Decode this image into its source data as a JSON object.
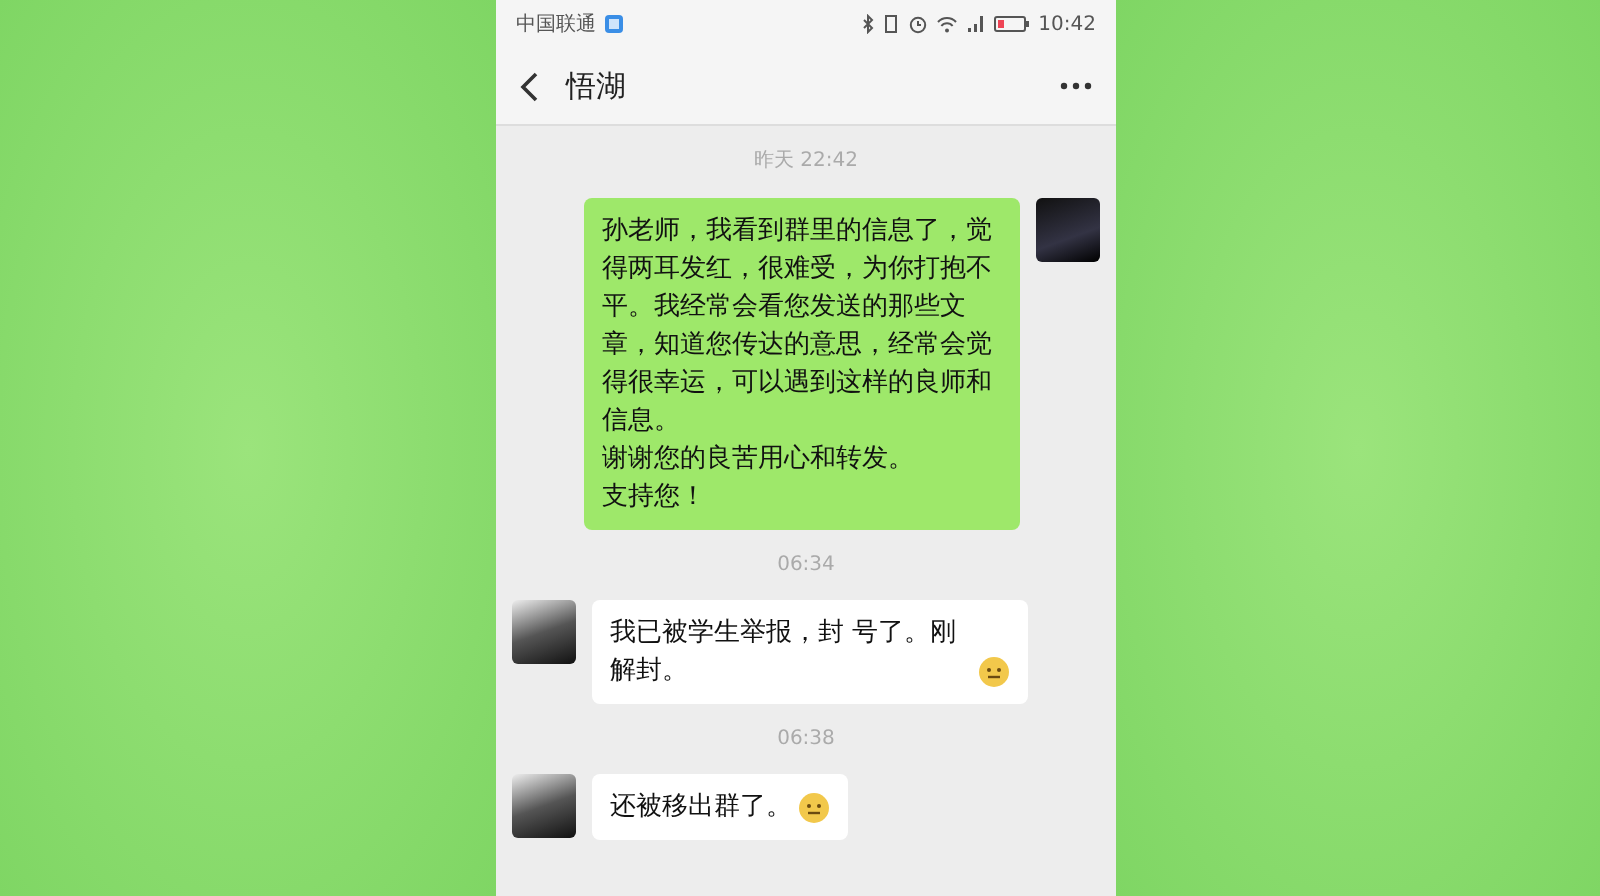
{
  "status_bar": {
    "carrier": "中国联通",
    "time": "10:42"
  },
  "header": {
    "title": "悟湖"
  },
  "messages": [
    {
      "kind": "timestamp",
      "text": "昨天 22:42"
    },
    {
      "kind": "outgoing",
      "paragraphs": [
        "孙老师，我看到群里的信息了，觉得两耳发红，很难受，为你打抱不平。我经常会看您发送的那些文章，知道您传达的意思，经常会觉得很幸运，可以遇到这样的良师和信息。",
        "谢谢您的良苦用心和转发。",
        "支持您！"
      ],
      "emoji": false
    },
    {
      "kind": "timestamp",
      "text": "06:34"
    },
    {
      "kind": "incoming",
      "text": "我已被学生举报，封 号了。刚解封。",
      "emoji": true
    },
    {
      "kind": "timestamp",
      "text": "06:38"
    },
    {
      "kind": "incoming",
      "text": "还被移出群了。",
      "emoji": true
    }
  ]
}
